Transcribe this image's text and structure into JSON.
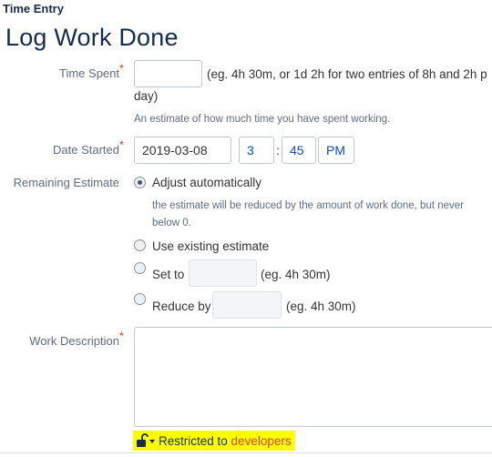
{
  "header": {
    "section_title": "Time Entry",
    "page_title": "Log Work Done"
  },
  "form": {
    "time_spent": {
      "label": "Time Spent",
      "required_marker": "*",
      "value": "",
      "hint_line1": "(eg. 4h 30m, or 1d 2h for two entries of 8h and 2h p",
      "hint_line2": "day)",
      "description": "An estimate of how much time you have spent working."
    },
    "date_started": {
      "label": "Date Started",
      "required_marker": "*",
      "date": "2019-03-08",
      "hour": "3",
      "separator": ":",
      "minute": "45",
      "ampm": "PM"
    },
    "remaining_estimate": {
      "label": "Remaining Estimate",
      "options": [
        {
          "label": "Adjust automatically",
          "checked": true,
          "description_line1": "the estimate will be reduced by the amount of work done, but never",
          "description_line2": "below 0."
        },
        {
          "label": "Use existing estimate",
          "checked": false
        },
        {
          "label": "Set to",
          "checked": false,
          "value": "",
          "hint": "(eg. 4h 30m)"
        },
        {
          "label": "Reduce by",
          "checked": false,
          "value": "",
          "hint": "(eg. 4h 30m)"
        }
      ]
    },
    "work_description": {
      "label": "Work Description",
      "required_marker": "*",
      "value": ""
    },
    "visibility": {
      "prefix": "Restricted to",
      "group": "developers"
    }
  },
  "icons": {
    "lock": "lock-open-icon",
    "dropdown": "caret-down-icon"
  },
  "colors": {
    "title": "#172b4d",
    "label": "#5e6c84",
    "required": "#de350b",
    "link": "#0052cc",
    "highlight": "#ffff00",
    "restricted_group": "#d04437"
  }
}
